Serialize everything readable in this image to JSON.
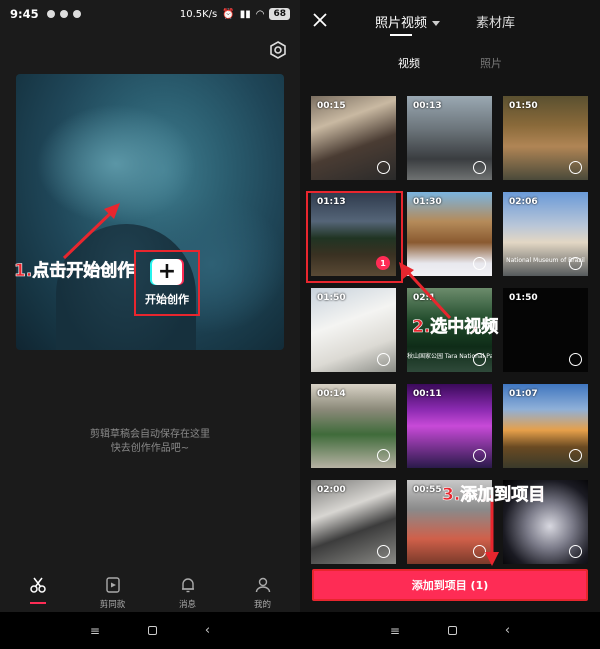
{
  "status_left": {
    "time": "9:45"
  },
  "status_right": {
    "speed": "10.5K/s",
    "battery": "68"
  },
  "left": {
    "start_label": "开始创作",
    "annotation1": "1.点击开始创作",
    "draft_tip_line1": "剪辑草稿会自动保存在这里",
    "draft_tip_line2": "快去创作作品吧~",
    "nav": [
      {
        "label": "",
        "icon": "scissors-icon"
      },
      {
        "label": "剪同款",
        "icon": "template-icon"
      },
      {
        "label": "消息",
        "icon": "bell-icon"
      },
      {
        "label": "我的",
        "icon": "profile-icon"
      }
    ]
  },
  "right": {
    "tabs": [
      {
        "label": "照片视频"
      },
      {
        "label": "素材库"
      }
    ],
    "subtabs": [
      {
        "label": "视频"
      },
      {
        "label": "照片"
      }
    ],
    "thumbs": [
      {
        "duration": "00:15",
        "scene": "crowd"
      },
      {
        "duration": "00:13",
        "scene": "street"
      },
      {
        "duration": "01:50",
        "scene": "wreck"
      },
      {
        "duration": "01:13",
        "scene": "lake",
        "selected_index": "1"
      },
      {
        "duration": "01:30",
        "scene": "cabin"
      },
      {
        "duration": "02:06",
        "scene": "museum",
        "caption": "National Museum of Brazil"
      },
      {
        "duration": "01:50",
        "scene": "bears"
      },
      {
        "duration": "02:1",
        "scene": "trees",
        "caption": "秋山国家公园  Tara National Park"
      },
      {
        "duration": "01:50",
        "scene": "black"
      },
      {
        "duration": "00:14",
        "scene": "plants"
      },
      {
        "duration": "00:11",
        "scene": "party"
      },
      {
        "duration": "01:07",
        "scene": "sunset"
      },
      {
        "duration": "02:00",
        "scene": "crowd2"
      },
      {
        "duration": "00:55",
        "scene": "track"
      },
      {
        "duration": "",
        "scene": "robot"
      }
    ],
    "annotation2": "2.选中视频",
    "annotation3": "3.添加到项目",
    "add_button": "添加到项目 (1)"
  },
  "colors": {
    "accent": "#fe2c55",
    "annotation": "#e8262e",
    "bg_dark": "#1b1b1b"
  }
}
